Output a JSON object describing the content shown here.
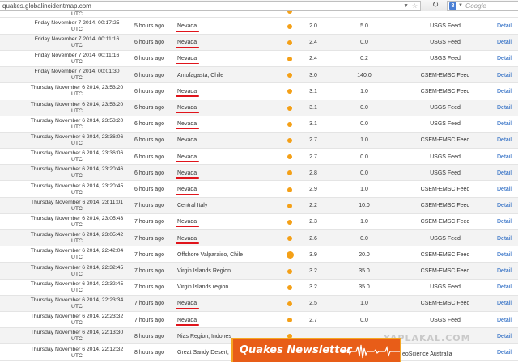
{
  "browser": {
    "url": "quakes.globalincidentmap.com",
    "search_placeholder": "Google",
    "search_badge": "8"
  },
  "partial_top_row": {
    "date_tail": "UTC"
  },
  "rows": [
    {
      "date_line1": "Friday November 7 2014, 00:17:25",
      "date_line2": "UTC",
      "ago": "5 hours ago",
      "location": "Nevada",
      "underlined": true,
      "big_dot": false,
      "magnitude": "2.0",
      "depth": "5.0",
      "feed": "USGS Feed",
      "detail": "Detail"
    },
    {
      "date_line1": "Friday November 7 2014, 00:11:16",
      "date_line2": "UTC",
      "ago": "6 hours ago",
      "location": "Nevada",
      "underlined": true,
      "big_dot": false,
      "magnitude": "2.4",
      "depth": "0.0",
      "feed": "USGS Feed",
      "detail": "Detail"
    },
    {
      "date_line1": "Friday November 7 2014, 00:11:16",
      "date_line2": "UTC",
      "ago": "6 hours ago",
      "location": "Nevada",
      "underlined": true,
      "big_dot": false,
      "magnitude": "2.4",
      "depth": "0.2",
      "feed": "USGS Feed",
      "detail": "Detail"
    },
    {
      "date_line1": "Friday November 7 2014, 00:01:30",
      "date_line2": "UTC",
      "ago": "6 hours ago",
      "location": "Antofagasta, Chile",
      "underlined": false,
      "big_dot": false,
      "magnitude": "3.0",
      "depth": "140.0",
      "feed": "CSEM-EMSC Feed",
      "detail": "Detail"
    },
    {
      "date_line1": "Thursday November 6 2014, 23:53:20",
      "date_line2": "UTC",
      "ago": "6 hours ago",
      "location": "Nevada",
      "underlined": true,
      "big_dot": false,
      "magnitude": "3.1",
      "depth": "1.0",
      "feed": "CSEM-EMSC Feed",
      "detail": "Detail"
    },
    {
      "date_line1": "Thursday November 6 2014, 23:53:20",
      "date_line2": "UTC",
      "ago": "6 hours ago",
      "location": "Nevada",
      "underlined": true,
      "big_dot": false,
      "magnitude": "3.1",
      "depth": "0.0",
      "feed": "USGS Feed",
      "detail": "Detail"
    },
    {
      "date_line1": "Thursday November 6 2014, 23:53:20",
      "date_line2": "UTC",
      "ago": "6 hours ago",
      "location": "Nevada",
      "underlined": true,
      "big_dot": false,
      "magnitude": "3.1",
      "depth": "0.0",
      "feed": "USGS Feed",
      "detail": "Detail"
    },
    {
      "date_line1": "Thursday November 6 2014, 23:36:06",
      "date_line2": "UTC",
      "ago": "6 hours ago",
      "location": "Nevada",
      "underlined": true,
      "big_dot": false,
      "magnitude": "2.7",
      "depth": "1.0",
      "feed": "CSEM-EMSC Feed",
      "detail": "Detail"
    },
    {
      "date_line1": "Thursday November 6 2014, 23:36:06",
      "date_line2": "UTC",
      "ago": "6 hours ago",
      "location": "Nevada",
      "underlined": true,
      "big_dot": false,
      "magnitude": "2.7",
      "depth": "0.0",
      "feed": "USGS Feed",
      "detail": "Detail"
    },
    {
      "date_line1": "Thursday November 6 2014, 23:20:46",
      "date_line2": "UTC",
      "ago": "6 hours ago",
      "location": "Nevada",
      "underlined": true,
      "big_dot": false,
      "magnitude": "2.8",
      "depth": "0.0",
      "feed": "USGS Feed",
      "detail": "Detail"
    },
    {
      "date_line1": "Thursday November 6 2014, 23:20:45",
      "date_line2": "UTC",
      "ago": "6 hours ago",
      "location": "Nevada",
      "underlined": true,
      "big_dot": false,
      "magnitude": "2.9",
      "depth": "1.0",
      "feed": "CSEM-EMSC Feed",
      "detail": "Detail"
    },
    {
      "date_line1": "Thursday November 6 2014, 23:11:01",
      "date_line2": "UTC",
      "ago": "7 hours ago",
      "location": "Central Italy",
      "underlined": false,
      "big_dot": false,
      "magnitude": "2.2",
      "depth": "10.0",
      "feed": "CSEM-EMSC Feed",
      "detail": "Detail"
    },
    {
      "date_line1": "Thursday November 6 2014, 23:05:43",
      "date_line2": "UTC",
      "ago": "7 hours ago",
      "location": "Nevada",
      "underlined": true,
      "big_dot": false,
      "magnitude": "2.3",
      "depth": "1.0",
      "feed": "CSEM-EMSC Feed",
      "detail": "Detail"
    },
    {
      "date_line1": "Thursday November 6 2014, 23:05:42",
      "date_line2": "UTC",
      "ago": "7 hours ago",
      "location": "Nevada",
      "underlined": true,
      "big_dot": false,
      "magnitude": "2.6",
      "depth": "0.0",
      "feed": "USGS Feed",
      "detail": "Detail"
    },
    {
      "date_line1": "Thursday November 6 2014, 22:42:04",
      "date_line2": "UTC",
      "ago": "7 hours ago",
      "location": "Offshore Valparaiso, Chile",
      "underlined": false,
      "big_dot": true,
      "magnitude": "3.9",
      "depth": "20.0",
      "feed": "CSEM-EMSC Feed",
      "detail": "Detail"
    },
    {
      "date_line1": "Thursday November 6 2014, 22:32:45",
      "date_line2": "UTC",
      "ago": "7 hours ago",
      "location": "Virgin Islands Region",
      "underlined": false,
      "big_dot": false,
      "magnitude": "3.2",
      "depth": "35.0",
      "feed": "CSEM-EMSC Feed",
      "detail": "Detail"
    },
    {
      "date_line1": "Thursday November 6 2014, 22:32:45",
      "date_line2": "UTC",
      "ago": "7 hours ago",
      "location": "Virgin Islands region",
      "underlined": false,
      "big_dot": false,
      "magnitude": "3.2",
      "depth": "35.0",
      "feed": "USGS Feed",
      "detail": "Detail"
    },
    {
      "date_line1": "Thursday November 6 2014, 22:23:34",
      "date_line2": "UTC",
      "ago": "7 hours ago",
      "location": "Nevada",
      "underlined": true,
      "big_dot": false,
      "magnitude": "2.5",
      "depth": "1.0",
      "feed": "CSEM-EMSC Feed",
      "detail": "Detail"
    },
    {
      "date_line1": "Thursday November 6 2014, 22:23:32",
      "date_line2": "UTC",
      "ago": "7 hours ago",
      "location": "Nevada",
      "underlined": true,
      "big_dot": false,
      "magnitude": "2.7",
      "depth": "0.0",
      "feed": "USGS Feed",
      "detail": "Detail"
    },
    {
      "date_line1": "Thursday November 6 2014, 22:13:30",
      "date_line2": "UTC",
      "ago": "8 hours ago",
      "location": "Nias Region, Indones",
      "underlined": false,
      "big_dot": false,
      "magnitude": "",
      "depth": "",
      "feed": "",
      "detail": "Detail"
    },
    {
      "date_line1": "Thursday November 6 2014, 22:12:32",
      "date_line2": "UTC",
      "ago": "8 hours ago",
      "location": "Great Sandy Desert,",
      "underlined": false,
      "big_dot": false,
      "magnitude": "",
      "depth": "",
      "feed": "",
      "detail": "Detail"
    }
  ],
  "partial_feed_text": "eoScience Australia",
  "newsletter": {
    "title": "Quakes Newsletter"
  },
  "watermark": "YAPLAKAL.COM",
  "colors": {
    "dot": "#f4a017",
    "underline": "#e0141b",
    "link": "#1a5fbf",
    "banner": "#e85d18"
  }
}
